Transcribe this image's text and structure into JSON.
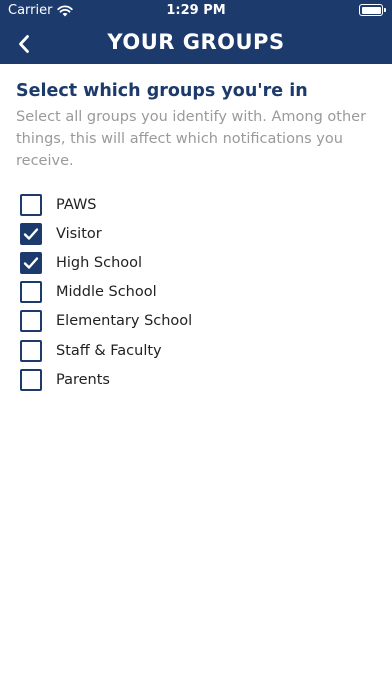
{
  "status_bar": {
    "carrier": "Carrier",
    "time": "1:29 PM"
  },
  "nav": {
    "title": "YOUR GROUPS"
  },
  "section": {
    "title": "Select which groups you're in",
    "description": "Select all groups you identify with. Among other things, this will affect which notifications you receive."
  },
  "groups": [
    {
      "label": "PAWS",
      "checked": false
    },
    {
      "label": "Visitor",
      "checked": true
    },
    {
      "label": "High School",
      "checked": true
    },
    {
      "label": "Middle School",
      "checked": false
    },
    {
      "label": "Elementary School",
      "checked": false
    },
    {
      "label": "Staff & Faculty",
      "checked": false
    },
    {
      "label": "Parents",
      "checked": false
    }
  ],
  "colors": {
    "primary": "#1c3a6b",
    "description_text": "#9a9a9a"
  }
}
